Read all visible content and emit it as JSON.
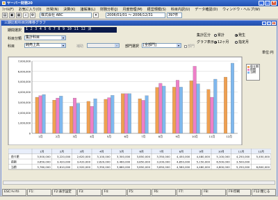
{
  "window": {
    "title": "ヤーバー財務20",
    "menu": [
      "ﾌｧｲﾙ(F)",
      "お気に入り(O)",
      "日常(N)",
      "決算(K)",
      "諸帳簿(L)",
      "財務分析(J)",
      "月度管理(M)",
      "経営規模(S)",
      "科目内訳(U)",
      "データ確認(D)",
      "ウィンドウ・ヘルプ(W)"
    ],
    "company_label": "株式会社 ABC",
    "period_text": "2006/01/01 ～ 2006/12/31",
    "count_text": "397件"
  },
  "child": {
    "title": "三期比較科目別推移グラフ",
    "period_label": "期間選択",
    "period_value": "1 2 3 4 5 6 7 8 9 10 11 12 決",
    "category_label": "科目分類",
    "category_value": "集計科目",
    "account_label": "科目",
    "account_value": "純売上高",
    "sub_label": "補助",
    "sub_value": "",
    "dept_label": "部門選択",
    "dept_value": "[全部門]",
    "dept_check_label": "部門",
    "agg_label": "集計区分",
    "agg_options": [
      "累計",
      "発生"
    ],
    "agg_selected": 1,
    "graph_label": "グラフ表示",
    "graph_options": [
      "12ヶ月",
      "指定月"
    ],
    "graph_selected": 0,
    "unit_label": "単位:円"
  },
  "chart_data": {
    "type": "bar",
    "categories": [
      "1月",
      "2月",
      "3月",
      "4月",
      "5月",
      "6月",
      "7月",
      "8月",
      "9月",
      "10月",
      "11月",
      "12月"
    ],
    "series": [
      {
        "name": "前々期",
        "color": "#f0a050",
        "values": [
          3500000,
          3220000,
          2620000,
          3100000,
          3300000,
          3850000,
          3350000,
          4450000,
          4480000,
          5100000,
          4250000,
          5450000
        ]
      },
      {
        "name": "前期",
        "color": "#ee7fc8",
        "values": [
          3650000,
          3420000,
          3420000,
          2620000,
          3460000,
          3850000,
          3200000,
          4850000,
          5150000,
          6500000,
          3500000,
          0
        ]
      },
      {
        "name": "当期",
        "color": "#7fb8ee",
        "values": [
          3760000,
          3610000,
          2920000,
          3350000,
          3680000,
          3850000,
          3650000,
          4580000,
          4480000,
          4800000,
          5250000,
          6800000
        ]
      }
    ],
    "ylim": [
      0,
      7000000
    ],
    "yticks": [
      "0",
      "1,000,000",
      "2,000,000",
      "3,000,000",
      "4,000,000",
      "5,000,000",
      "6,000,000",
      "7,000,000"
    ],
    "grid": true,
    "legend_position": "right"
  },
  "table": {
    "headers": [
      "",
      "1月",
      "2月",
      "3月",
      "4月",
      "5月",
      "6月",
      "7月",
      "8月",
      "9月",
      "10月",
      "11月",
      "12月"
    ],
    "rows": [
      [
        "前々期",
        "3,500,000",
        "3,220,000",
        "2,620,000",
        "3,100,000",
        "3,300,000",
        "3,850,000",
        "3,350,000",
        "4,450,000",
        "4,480,000",
        "5,100,000",
        "4,250,000",
        "5,450,000"
      ],
      [
        "前期",
        "3,650,000",
        "3,420,000",
        "3,420,000",
        "2,620,000",
        "3,460,000",
        "3,850,000",
        "3,200,000",
        "4,850,000",
        "5,150,000",
        "6,500,000",
        "3,500,000",
        ""
      ],
      [
        "当期",
        "3,760,000",
        "3,610,000",
        "2,920,000",
        "3,350,000",
        "3,680,000",
        "3,850,000",
        "3,650,000",
        "4,580,000",
        "4,480,000",
        "4,800,000",
        "5,250,000",
        "6,800,000"
      ]
    ]
  },
  "fkeys": [
    "ESC:ｷｬﾝｾﾙ",
    "F1:",
    "F2:表示設定",
    "F3:",
    "F4:",
    "F5:",
    "F6:",
    "F7:",
    "F8:",
    "F9:印刷",
    "F12:閉じる"
  ]
}
